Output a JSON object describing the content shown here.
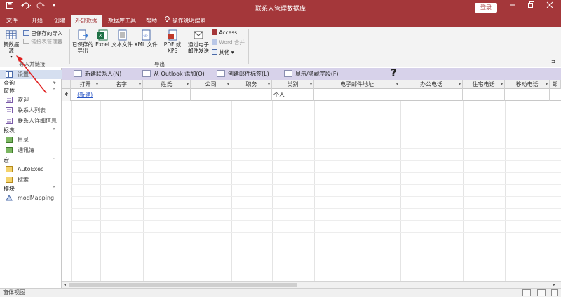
{
  "titlebar": {
    "save_icon": "save-icon",
    "undo_icon": "undo-icon",
    "redo_icon": "redo-icon",
    "title": "联系人管理数据库",
    "login_label": "登录",
    "minimize": "—",
    "restore": "▢",
    "close": "✕"
  },
  "tabs": [
    {
      "label": "文件"
    },
    {
      "label": "开始"
    },
    {
      "label": "创建"
    },
    {
      "label": "外部数据"
    },
    {
      "label": "数据库工具"
    },
    {
      "label": "帮助"
    },
    {
      "label": "操作说明搜索"
    }
  ],
  "ribbon": {
    "new_datasource": "新数据\n源",
    "saved_imports": "已保存的导入",
    "linked_table_manager": "链接表管理器",
    "import_group_label": "导入并链接",
    "saved_exports": "已保存的\n导出",
    "excel": "Excel",
    "text_file": "文本文件",
    "xml_file": "XML 文件",
    "pdf_xps": "PDF 或 XPS",
    "email": "通过电子\n邮件发送",
    "access": "Access",
    "word_merge": "Word 合并",
    "other": "其他",
    "export_group_label": "导出",
    "collapse": "⊐"
  },
  "nav": {
    "headers": [
      {
        "label": "表",
        "chev": "≪"
      },
      {
        "label": "查询",
        "chev": "¥"
      },
      {
        "label": "窗体",
        "chev": "≈"
      },
      {
        "label": "报表",
        "chev": "≈"
      },
      {
        "label": "宏",
        "chev": "≈"
      },
      {
        "label": "模块",
        "chev": "≈"
      }
    ],
    "items": [
      {
        "label": "设置"
      },
      {
        "label": "欢迎"
      },
      {
        "label": "联系人列表"
      },
      {
        "label": "联系人详细信息"
      },
      {
        "label": "目录"
      },
      {
        "label": "通讯簿"
      },
      {
        "label": "AutoExec"
      },
      {
        "label": "搜索"
      },
      {
        "label": "modMapping"
      }
    ]
  },
  "formbar": {
    "new_contact": "新建联系人(N)",
    "add_from_outlook": "从 Outlook 添加(O)",
    "create_labels": "创建邮件标签(L)",
    "show_hide_fields": "显示/隐藏字段(F)",
    "help_mark": "?"
  },
  "grid": {
    "columns": [
      "打开",
      "名字",
      "姓氏",
      "公司",
      "职务",
      "类别",
      "电子邮件地址",
      "办公电话",
      "住宅电话",
      "移动电话",
      "邮"
    ],
    "new_row": {
      "open_link": "(新建)",
      "category": "个人"
    },
    "selector_mark": "✱"
  },
  "status": {
    "text": "窗体视图"
  }
}
